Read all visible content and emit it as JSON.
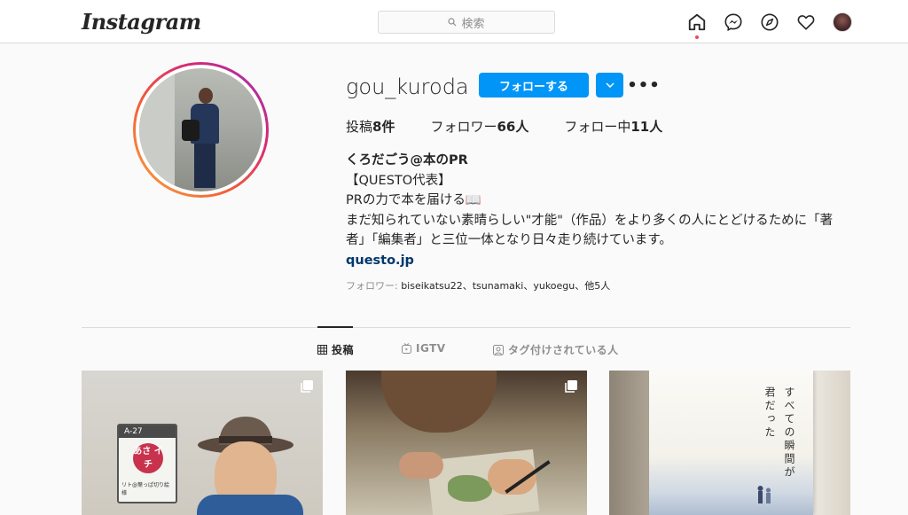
{
  "topbar": {
    "logo": "Instagram",
    "search_placeholder": "検索"
  },
  "profile": {
    "username": "gou_kuroda",
    "follow_label": "フォローする",
    "more_label": "•••",
    "stats": {
      "posts_label": "投稿",
      "posts_count": "8件",
      "followers_label": "フォロワー",
      "followers_count": "66人",
      "following_label": "フォロー中",
      "following_count": "11人"
    },
    "bio": {
      "display_name": "くろだごう@本のPR",
      "line1": "【QUESTO代表】",
      "line2": "PRの力で本を届ける📖",
      "line3": "まだ知られていない素晴らしい\"才能\"（作品）をより多くの人にとどけるために「著",
      "line4": "者」「編集者」と三位一体となり日々走り続けています。",
      "link": "questo.jp"
    },
    "followed_by": {
      "prefix": "フォロワー: ",
      "names": "biseikatsu22、tsunamaki、yukoegu、他5人"
    }
  },
  "tabs": {
    "posts": "投稿",
    "igtv": "IGTV",
    "tagged": "タグ付けされている人"
  },
  "posts": {
    "p1_sign_top": "A-27",
    "p1_sign_circle": "あさ イチ",
    "p1_sign_text": "リト@葉っぱ切り絵 様",
    "p3_title_a": "すべての瞬間が",
    "p3_title_b": "君だった"
  },
  "colors": {
    "accent": "#0095f6",
    "link": "#00376b",
    "notification_dot": "#ed4956"
  }
}
